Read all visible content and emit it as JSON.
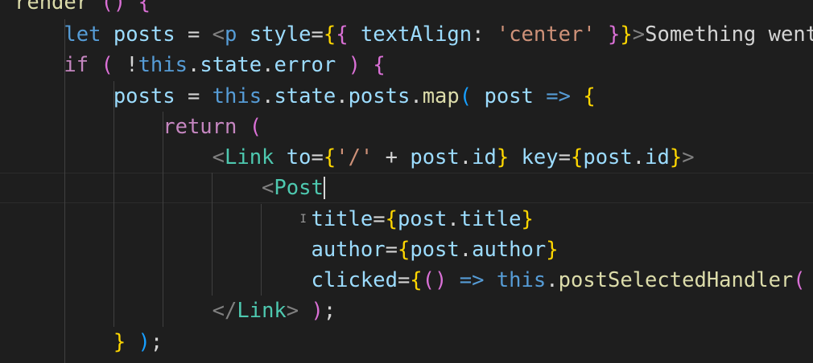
{
  "editor": {
    "language": "javascript-jsx",
    "theme_colors": {
      "background": "#1e1e1e",
      "keyword": "#c586c0",
      "storage": "#569cd6",
      "variable": "#9cdcfe",
      "function": "#dcdcaa",
      "string": "#ce9178",
      "component": "#4ec9b0",
      "bracket_gold": "#ffd700",
      "bracket_purple": "#da70d6",
      "bracket_blue": "#179fff"
    },
    "lines": [
      {
        "tokens": [
          {
            "t": "render",
            "c": "fn"
          },
          {
            "t": " ",
            "c": "txt"
          },
          {
            "t": "()",
            "c": "br2"
          },
          {
            "t": " ",
            "c": "txt"
          },
          {
            "t": "{",
            "c": "br2"
          }
        ]
      },
      {
        "tokens": [
          {
            "t": "    ",
            "c": "txt"
          },
          {
            "t": "let",
            "c": "kb"
          },
          {
            "t": " ",
            "c": "txt"
          },
          {
            "t": "posts",
            "c": "var"
          },
          {
            "t": " = ",
            "c": "txt"
          },
          {
            "t": "<",
            "c": "punc"
          },
          {
            "t": "p",
            "c": "kb"
          },
          {
            "t": " ",
            "c": "txt"
          },
          {
            "t": "style",
            "c": "var"
          },
          {
            "t": "=",
            "c": "txt"
          },
          {
            "t": "{",
            "c": "br1"
          },
          {
            "t": "{",
            "c": "br2"
          },
          {
            "t": " ",
            "c": "txt"
          },
          {
            "t": "textAlign",
            "c": "var"
          },
          {
            "t": ": ",
            "c": "txt"
          },
          {
            "t": "'center'",
            "c": "str"
          },
          {
            "t": " ",
            "c": "txt"
          },
          {
            "t": "}",
            "c": "br2"
          },
          {
            "t": "}",
            "c": "br1"
          },
          {
            "t": ">",
            "c": "punc"
          },
          {
            "t": "Something went",
            "c": "txt"
          }
        ]
      },
      {
        "tokens": [
          {
            "t": "    ",
            "c": "txt"
          },
          {
            "t": "if",
            "c": "kw"
          },
          {
            "t": " ",
            "c": "txt"
          },
          {
            "t": "(",
            "c": "br2"
          },
          {
            "t": " !",
            "c": "txt"
          },
          {
            "t": "this",
            "c": "kb"
          },
          {
            "t": ".",
            "c": "txt"
          },
          {
            "t": "state",
            "c": "var"
          },
          {
            "t": ".",
            "c": "txt"
          },
          {
            "t": "error",
            "c": "var"
          },
          {
            "t": " ",
            "c": "txt"
          },
          {
            "t": ")",
            "c": "br2"
          },
          {
            "t": " ",
            "c": "txt"
          },
          {
            "t": "{",
            "c": "br2"
          }
        ]
      },
      {
        "tokens": [
          {
            "t": "        ",
            "c": "txt"
          },
          {
            "t": "posts",
            "c": "var"
          },
          {
            "t": " = ",
            "c": "txt"
          },
          {
            "t": "this",
            "c": "kb"
          },
          {
            "t": ".",
            "c": "txt"
          },
          {
            "t": "state",
            "c": "var"
          },
          {
            "t": ".",
            "c": "txt"
          },
          {
            "t": "posts",
            "c": "var"
          },
          {
            "t": ".",
            "c": "txt"
          },
          {
            "t": "map",
            "c": "fn"
          },
          {
            "t": "(",
            "c": "br3"
          },
          {
            "t": " ",
            "c": "txt"
          },
          {
            "t": "post",
            "c": "var"
          },
          {
            "t": " ",
            "c": "txt"
          },
          {
            "t": "=>",
            "c": "kb"
          },
          {
            "t": " ",
            "c": "txt"
          },
          {
            "t": "{",
            "c": "br1"
          }
        ]
      },
      {
        "tokens": [
          {
            "t": "            ",
            "c": "txt"
          },
          {
            "t": "return",
            "c": "kw"
          },
          {
            "t": " ",
            "c": "txt"
          },
          {
            "t": "(",
            "c": "br2"
          }
        ]
      },
      {
        "tokens": [
          {
            "t": "                ",
            "c": "txt"
          },
          {
            "t": "<",
            "c": "punc"
          },
          {
            "t": "Link",
            "c": "tag"
          },
          {
            "t": " ",
            "c": "txt"
          },
          {
            "t": "to",
            "c": "var"
          },
          {
            "t": "=",
            "c": "txt"
          },
          {
            "t": "{",
            "c": "br1"
          },
          {
            "t": "'/'",
            "c": "str"
          },
          {
            "t": " + ",
            "c": "txt"
          },
          {
            "t": "post",
            "c": "var"
          },
          {
            "t": ".",
            "c": "txt"
          },
          {
            "t": "id",
            "c": "var"
          },
          {
            "t": "}",
            "c": "br1"
          },
          {
            "t": " ",
            "c": "txt"
          },
          {
            "t": "key",
            "c": "var"
          },
          {
            "t": "=",
            "c": "txt"
          },
          {
            "t": "{",
            "c": "br1"
          },
          {
            "t": "post",
            "c": "var"
          },
          {
            "t": ".",
            "c": "txt"
          },
          {
            "t": "id",
            "c": "var"
          },
          {
            "t": "}",
            "c": "br1"
          },
          {
            "t": ">",
            "c": "punc"
          }
        ]
      },
      {
        "tokens": [
          {
            "t": "                    ",
            "c": "txt"
          },
          {
            "t": "<",
            "c": "punc"
          },
          {
            "t": "Post",
            "c": "tag"
          }
        ],
        "cursor": true
      },
      {
        "tokens": [
          {
            "t": "                        ",
            "c": "txt"
          },
          {
            "t": "title",
            "c": "var"
          },
          {
            "t": "=",
            "c": "txt"
          },
          {
            "t": "{",
            "c": "br1"
          },
          {
            "t": "post",
            "c": "var"
          },
          {
            "t": ".",
            "c": "txt"
          },
          {
            "t": "title",
            "c": "var"
          },
          {
            "t": "}",
            "c": "br1"
          }
        ],
        "ibeam": true
      },
      {
        "tokens": [
          {
            "t": "                        ",
            "c": "txt"
          },
          {
            "t": "author",
            "c": "var"
          },
          {
            "t": "=",
            "c": "txt"
          },
          {
            "t": "{",
            "c": "br1"
          },
          {
            "t": "post",
            "c": "var"
          },
          {
            "t": ".",
            "c": "txt"
          },
          {
            "t": "author",
            "c": "var"
          },
          {
            "t": "}",
            "c": "br1"
          }
        ]
      },
      {
        "tokens": [
          {
            "t": "                        ",
            "c": "txt"
          },
          {
            "t": "clicked",
            "c": "var"
          },
          {
            "t": "=",
            "c": "txt"
          },
          {
            "t": "{",
            "c": "br1"
          },
          {
            "t": "()",
            "c": "br2"
          },
          {
            "t": " ",
            "c": "txt"
          },
          {
            "t": "=>",
            "c": "kb"
          },
          {
            "t": " ",
            "c": "txt"
          },
          {
            "t": "this",
            "c": "kb"
          },
          {
            "t": ".",
            "c": "txt"
          },
          {
            "t": "postSelectedHandler",
            "c": "fn"
          },
          {
            "t": "(",
            "c": "br2"
          }
        ]
      },
      {
        "tokens": [
          {
            "t": "                ",
            "c": "txt"
          },
          {
            "t": "</",
            "c": "punc"
          },
          {
            "t": "Link",
            "c": "tag"
          },
          {
            "t": ">",
            "c": "punc"
          },
          {
            "t": " ",
            "c": "txt"
          },
          {
            "t": ")",
            "c": "br2"
          },
          {
            "t": ";",
            "c": "txt"
          }
        ]
      },
      {
        "tokens": [
          {
            "t": "        ",
            "c": "txt"
          },
          {
            "t": "}",
            "c": "br1"
          },
          {
            "t": " ",
            "c": "txt"
          },
          {
            "t": ")",
            "c": "br3"
          },
          {
            "t": ";",
            "c": "txt"
          }
        ]
      }
    ]
  }
}
